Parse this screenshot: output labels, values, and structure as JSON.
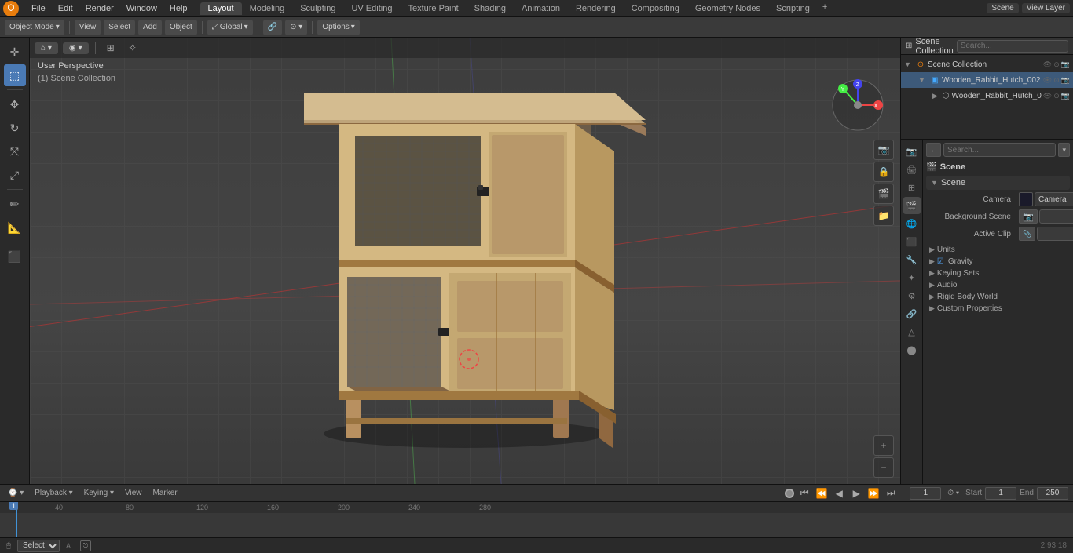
{
  "app": {
    "title": "Blender",
    "version": "2.93.18"
  },
  "topmenu": {
    "items": [
      "File",
      "Edit",
      "Render",
      "Window",
      "Help"
    ]
  },
  "workspaces": {
    "tabs": [
      "Layout",
      "Modeling",
      "Sculpting",
      "UV Editing",
      "Texture Paint",
      "Shading",
      "Animation",
      "Rendering",
      "Compositing",
      "Geometry Nodes",
      "Scripting"
    ],
    "active": "Layout"
  },
  "viewport": {
    "mode": "Object Mode",
    "view": "View",
    "select": "Select",
    "add": "Add",
    "object": "Object",
    "perspective_label": "User Perspective",
    "collection_label": "(1) Scene Collection",
    "options_btn": "Options",
    "transform": "Global"
  },
  "outliner": {
    "title": "Scene Collection",
    "items": [
      {
        "label": "Wooden_Rabbit_Hutch_002",
        "indent": 0,
        "expanded": true,
        "icon": "▼",
        "has_expand": true
      },
      {
        "label": "Wooden_Rabbit_Hutch_0",
        "indent": 1,
        "expanded": false,
        "icon": "▶",
        "has_expand": true
      }
    ]
  },
  "properties": {
    "active_tab": "scene",
    "tabs": [
      "render",
      "output",
      "view_layer",
      "scene",
      "world",
      "object",
      "modifier",
      "particles",
      "physics",
      "constraint",
      "object_data",
      "material",
      "collection"
    ],
    "scene_header": "Scene",
    "scene_section": "Scene",
    "camera_label": "Camera",
    "background_scene_label": "Background Scene",
    "active_clip_label": "Active Clip",
    "units_label": "Units",
    "gravity_label": "Gravity",
    "keying_sets_label": "Keying Sets",
    "audio_label": "Audio",
    "rigid_body_world_label": "Rigid Body World",
    "custom_properties_label": "Custom Properties",
    "gravity_checked": true
  },
  "timeline": {
    "playback_label": "Playback",
    "keying_label": "Keying",
    "view_label": "View",
    "marker_label": "Marker",
    "frame_current": "1",
    "frame_start_label": "Start",
    "frame_start": "1",
    "frame_end_label": "End",
    "frame_end": "250",
    "numbers": [
      "1",
      "40",
      "80",
      "120",
      "160",
      "200",
      "240",
      "280"
    ]
  },
  "statusbar": {
    "select_label": "Select",
    "select_key": "A",
    "version": "2.93.18"
  },
  "colors": {
    "accent": "#e87d0d",
    "active_blue": "#4a7ab5",
    "header_bg": "#2a2a2a",
    "panel_bg": "#2a2a2a",
    "section_bg": "#333333"
  }
}
